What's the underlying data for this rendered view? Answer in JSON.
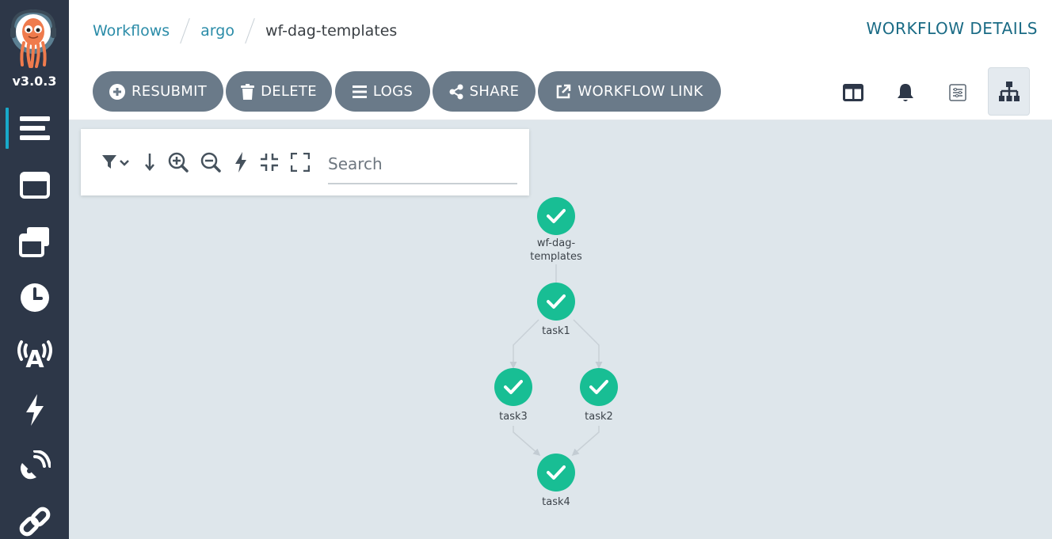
{
  "sidebar": {
    "version": "v3.0.3",
    "items": [
      {
        "icon": "workflows-icon"
      },
      {
        "icon": "workflow-templates-icon"
      },
      {
        "icon": "cluster-workflow-templates-icon"
      },
      {
        "icon": "cron-workflows-icon"
      },
      {
        "icon": "event-sources-icon"
      },
      {
        "icon": "sensors-icon"
      },
      {
        "icon": "event-flow-icon"
      },
      {
        "icon": "link-icon"
      }
    ]
  },
  "breadcrumb": {
    "items": [
      "Workflows",
      "argo"
    ],
    "current": "wf-dag-templates"
  },
  "header": {
    "title": "WORKFLOW DETAILS"
  },
  "toolbar": {
    "buttons": {
      "resubmit": "RESUBMIT",
      "delete": "DELETE",
      "logs": "LOGS",
      "share": "SHARE",
      "workflow_link": "WORKFLOW LINK"
    },
    "view_icons": [
      "split-view-icon",
      "bell-icon",
      "list-view-icon",
      "dag-view-icon"
    ]
  },
  "graph_panel": {
    "icons": [
      "filter-icon",
      "direction-icon",
      "zoom-in-icon",
      "zoom-out-icon",
      "fast-layout-icon",
      "collapse-icon",
      "expand-icon"
    ],
    "search_placeholder": "Search"
  },
  "graph": {
    "nodes": [
      {
        "id": "root",
        "label_lines": [
          "wf-dag-",
          "templates"
        ],
        "status": "succeeded"
      },
      {
        "id": "task1",
        "label_lines": [
          "task1"
        ],
        "status": "succeeded"
      },
      {
        "id": "task3",
        "label_lines": [
          "task3"
        ],
        "status": "succeeded"
      },
      {
        "id": "task2",
        "label_lines": [
          "task2"
        ],
        "status": "succeeded"
      },
      {
        "id": "task4",
        "label_lines": [
          "task4"
        ],
        "status": "succeeded"
      }
    ],
    "edges": [
      [
        "root",
        "task1"
      ],
      [
        "task1",
        "task3"
      ],
      [
        "task1",
        "task2"
      ],
      [
        "task3",
        "task4"
      ],
      [
        "task2",
        "task4"
      ]
    ]
  },
  "colors": {
    "sidebar_bg": "#2d3748",
    "accent": "#18a9c9",
    "button_bg": "#6a7a89",
    "success": "#18be94",
    "canvas_bg": "#dee6eb",
    "link": "#2b8ca8"
  }
}
